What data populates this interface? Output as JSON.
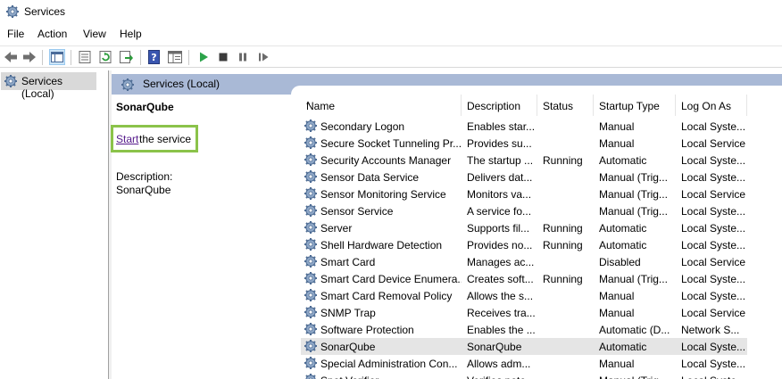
{
  "window": {
    "title": "Services"
  },
  "menu": [
    "File",
    "Action",
    "View",
    "Help"
  ],
  "tree": {
    "item": "Services (Local)"
  },
  "panel": {
    "header": "Services (Local)",
    "service_name": "SonarQube",
    "start_link": "Start",
    "start_rest": " the service",
    "description_label": "Description:",
    "description_value": "SonarQube"
  },
  "table": {
    "headers": [
      "Name",
      "Description",
      "Status",
      "Startup Type",
      "Log On As"
    ],
    "sorted_column": "Name",
    "rows": [
      {
        "name": "Secondary Logon",
        "description": "Enables star...",
        "status": "",
        "startup": "Manual",
        "logon": "Local Syste..."
      },
      {
        "name": "Secure Socket Tunneling Pr...",
        "description": "Provides su...",
        "status": "",
        "startup": "Manual",
        "logon": "Local Service"
      },
      {
        "name": "Security Accounts Manager",
        "description": "The startup ...",
        "status": "Running",
        "startup": "Automatic",
        "logon": "Local Syste..."
      },
      {
        "name": "Sensor Data Service",
        "description": "Delivers dat...",
        "status": "",
        "startup": "Manual (Trig...",
        "logon": "Local Syste..."
      },
      {
        "name": "Sensor Monitoring Service",
        "description": "Monitors va...",
        "status": "",
        "startup": "Manual (Trig...",
        "logon": "Local Service"
      },
      {
        "name": "Sensor Service",
        "description": "A service fo...",
        "status": "",
        "startup": "Manual (Trig...",
        "logon": "Local Syste..."
      },
      {
        "name": "Server",
        "description": "Supports fil...",
        "status": "Running",
        "startup": "Automatic",
        "logon": "Local Syste..."
      },
      {
        "name": "Shell Hardware Detection",
        "description": "Provides no...",
        "status": "Running",
        "startup": "Automatic",
        "logon": "Local Syste..."
      },
      {
        "name": "Smart Card",
        "description": "Manages ac...",
        "status": "",
        "startup": "Disabled",
        "logon": "Local Service"
      },
      {
        "name": "Smart Card Device Enumera...",
        "description": "Creates soft...",
        "status": "Running",
        "startup": "Manual (Trig...",
        "logon": "Local Syste..."
      },
      {
        "name": "Smart Card Removal Policy",
        "description": "Allows the s...",
        "status": "",
        "startup": "Manual",
        "logon": "Local Syste..."
      },
      {
        "name": "SNMP Trap",
        "description": "Receives tra...",
        "status": "",
        "startup": "Manual",
        "logon": "Local Service"
      },
      {
        "name": "Software Protection",
        "description": "Enables the ...",
        "status": "",
        "startup": "Automatic (D...",
        "logon": "Network S..."
      },
      {
        "name": "SonarQube",
        "description": "SonarQube",
        "status": "",
        "startup": "Automatic",
        "logon": "Local Syste...",
        "selected": true
      },
      {
        "name": "Special Administration Con...",
        "description": "Allows adm...",
        "status": "",
        "startup": "Manual",
        "logon": "Local Syste..."
      },
      {
        "name": "Spot Verifier",
        "description": "Verifies pote...",
        "status": "",
        "startup": "Manual (Trig...",
        "logon": "Local Syste..."
      }
    ]
  },
  "colors": {
    "header_bar": "#a9b9d6",
    "highlight_box": "#8bc34a",
    "selected_row": "#e5e5e5",
    "link": "#551a8b"
  },
  "icons": [
    "services-gear-icon",
    "back-arrow-icon",
    "forward-arrow-icon",
    "show-hide-tree-icon",
    "properties-icon",
    "refresh-icon",
    "export-list-icon",
    "help-icon",
    "extended-view-icon",
    "play-icon",
    "stop-icon",
    "pause-icon",
    "resume-icon"
  ]
}
